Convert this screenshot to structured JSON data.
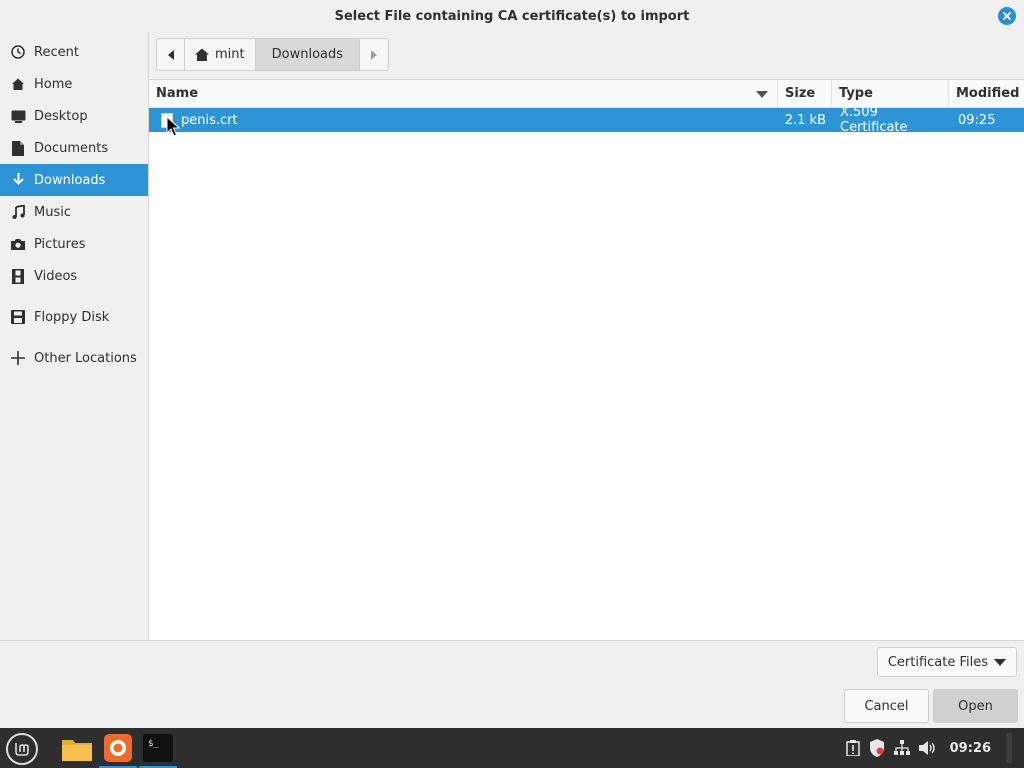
{
  "window": {
    "title": "Select File containing CA certificate(s) to import",
    "close_icon": "close-icon"
  },
  "sidebar": {
    "items": [
      {
        "label": "Recent",
        "icon": "clock-icon"
      },
      {
        "label": "Home",
        "icon": "home-icon"
      },
      {
        "label": "Desktop",
        "icon": "desktop-icon"
      },
      {
        "label": "Documents",
        "icon": "documents-icon"
      },
      {
        "label": "Downloads",
        "icon": "download-icon",
        "active": true
      },
      {
        "label": "Music",
        "icon": "music-icon"
      },
      {
        "label": "Pictures",
        "icon": "camera-icon"
      },
      {
        "label": "Videos",
        "icon": "film-icon"
      },
      {
        "label": "Floppy Disk",
        "icon": "floppy-icon"
      },
      {
        "label": "Other Locations",
        "icon": "plus-icon"
      }
    ]
  },
  "pathbar": {
    "segments": [
      "mint",
      "Downloads"
    ],
    "current": "Downloads"
  },
  "filelist": {
    "columns": {
      "name": "Name",
      "size": "Size",
      "type": "Type",
      "modified": "Modified"
    },
    "rows": [
      {
        "name": "penis.crt",
        "size": "2.1 kB",
        "type": "X.509 Certificate",
        "modified": "09:25",
        "selected": true
      }
    ]
  },
  "footer": {
    "filter": "Certificate Files",
    "cancel": "Cancel",
    "open": "Open"
  },
  "taskbar": {
    "clock": "09:26",
    "apps": [
      "files-icon",
      "firefox-icon",
      "terminal-icon"
    ]
  },
  "colors": {
    "accent": "#2d94d6",
    "taskbar": "#2e2e2e"
  }
}
